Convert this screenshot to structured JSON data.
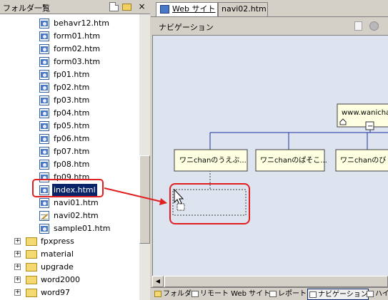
{
  "folder_pane": {
    "title": "フォルダ一覧",
    "files": [
      {
        "name": "behavr12.htm",
        "icon": "html-file-icon"
      },
      {
        "name": "form01.htm",
        "icon": "html-file-icon"
      },
      {
        "name": "form02.htm",
        "icon": "html-file-icon"
      },
      {
        "name": "form03.htm",
        "icon": "html-file-icon"
      },
      {
        "name": "fp01.htm",
        "icon": "html-file-icon"
      },
      {
        "name": "fp02.htm",
        "icon": "html-file-icon"
      },
      {
        "name": "fp03.htm",
        "icon": "html-file-icon"
      },
      {
        "name": "fp04.htm",
        "icon": "html-file-icon"
      },
      {
        "name": "fp05.htm",
        "icon": "html-file-icon"
      },
      {
        "name": "fp06.htm",
        "icon": "html-file-icon"
      },
      {
        "name": "fp07.htm",
        "icon": "html-file-icon"
      },
      {
        "name": "fp08.htm",
        "icon": "html-file-icon"
      },
      {
        "name": "fp09.htm",
        "icon": "html-file-icon"
      },
      {
        "name": "index.html",
        "icon": "html-file-icon"
      },
      {
        "name": "navi01.htm",
        "icon": "html-file-icon"
      },
      {
        "name": "navi02.htm",
        "icon": "edit-file-icon"
      },
      {
        "name": "sample01.htm",
        "icon": "html-file-icon"
      }
    ],
    "folders": [
      {
        "name": "fpxpress",
        "expander": "+"
      },
      {
        "name": "material",
        "expander": "+"
      },
      {
        "name": "upgrade",
        "expander": "+"
      },
      {
        "name": "word2000",
        "expander": "+"
      },
      {
        "name": "word97",
        "expander": "+"
      }
    ],
    "close_glyph": "×"
  },
  "tabs": [
    {
      "label": "Web サイト"
    },
    {
      "label": "navi02.htm"
    }
  ],
  "navigation": {
    "title": "ナビゲーション",
    "root_node": "www.wanicha",
    "collapse_glyph": "−",
    "child_nodes": [
      {
        "label": "ワニchanのうえぶ..."
      },
      {
        "label": "ワニchanのぱそこ..."
      },
      {
        "label": "ワニchanのび"
      }
    ]
  },
  "view_bar": {
    "folders": "フォルダ",
    "remote": "リモート Web サイト",
    "reports": "レポート",
    "navigation": "ナビゲーション",
    "hyperlinks": "ハイ"
  },
  "scroll_glyph": "◀",
  "colors": {
    "selection": "#0a246a",
    "annotation": "#e02020",
    "canvas": "#dde4f0",
    "node_fill": "#ffffe1",
    "connector": "#1a2fa0"
  }
}
